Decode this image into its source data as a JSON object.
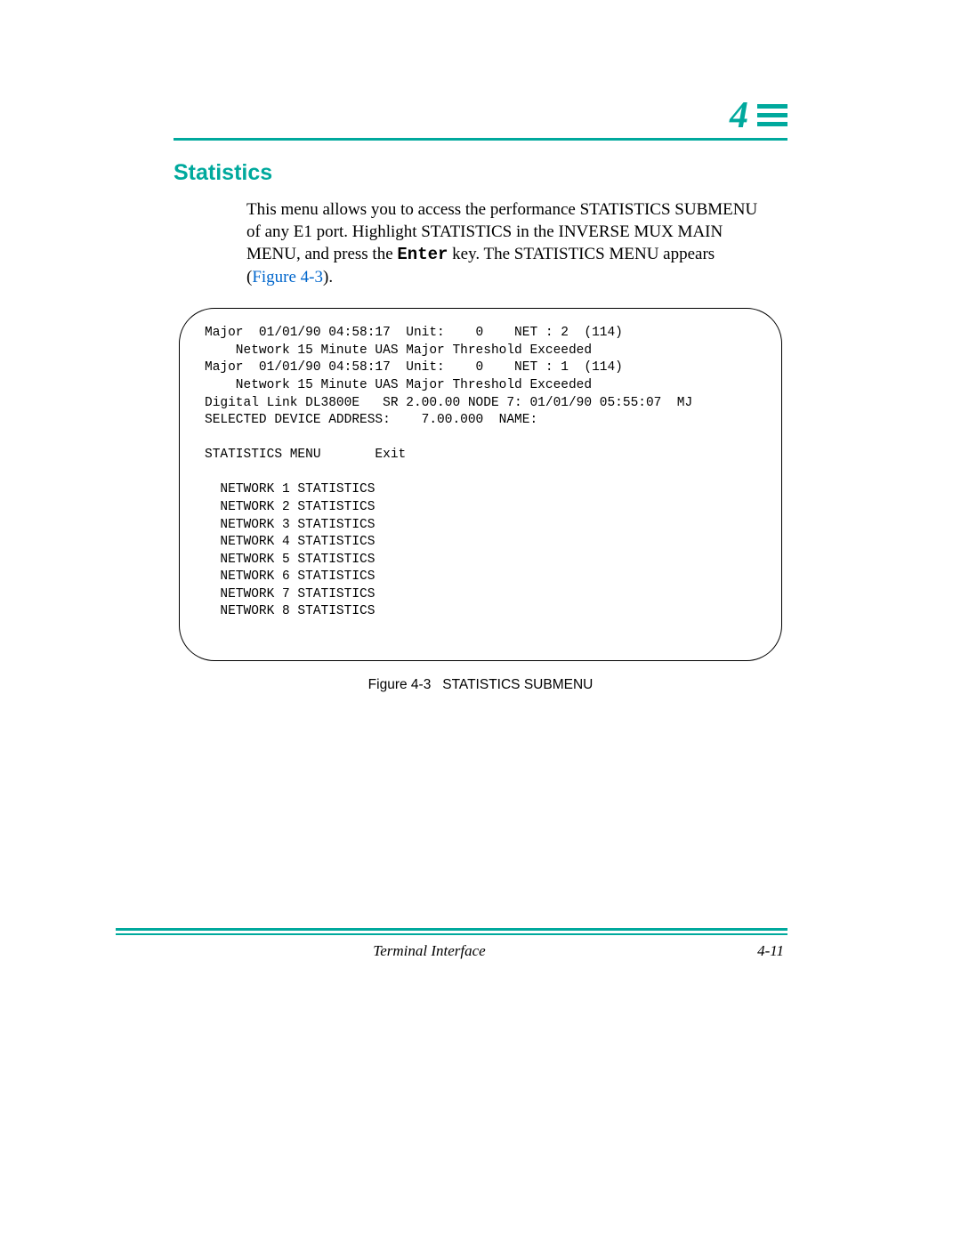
{
  "chapter_number": "4",
  "section_title": "Statistics",
  "intro": {
    "line1": "This menu allows you to access the performance STATISTICS SUBMENU",
    "line2a": "of any E1 port. Highlight STATISTICS in the INVERSE MUX MAIN",
    "line3a": "MENU, and press the ",
    "keyname": "Enter",
    "line3b": " key. The STATISTICS MENU appears",
    "line4a": " (",
    "figref": "Figure 4-3",
    "line4b": ")."
  },
  "terminal": "Major  01/01/90 04:58:17  Unit:    0    NET : 2  (114)\n    Network 15 Minute UAS Major Threshold Exceeded\nMajor  01/01/90 04:58:17  Unit:    0    NET : 1  (114)\n    Network 15 Minute UAS Major Threshold Exceeded\nDigital Link DL3800E   SR 2.00.00 NODE 7: 01/01/90 05:55:07  MJ\nSELECTED DEVICE ADDRESS:    7.00.000  NAME:\n\nSTATISTICS MENU       Exit\n\n  NETWORK 1 STATISTICS\n  NETWORK 2 STATISTICS\n  NETWORK 3 STATISTICS\n  NETWORK 4 STATISTICS\n  NETWORK 5 STATISTICS\n  NETWORK 6 STATISTICS\n  NETWORK 7 STATISTICS\n  NETWORK 8 STATISTICS",
  "figure_caption_prefix": "Figure 4-3",
  "figure_caption_text": "STATISTICS SUBMENU",
  "footer_center": "Terminal Interface",
  "footer_page": "4-11"
}
